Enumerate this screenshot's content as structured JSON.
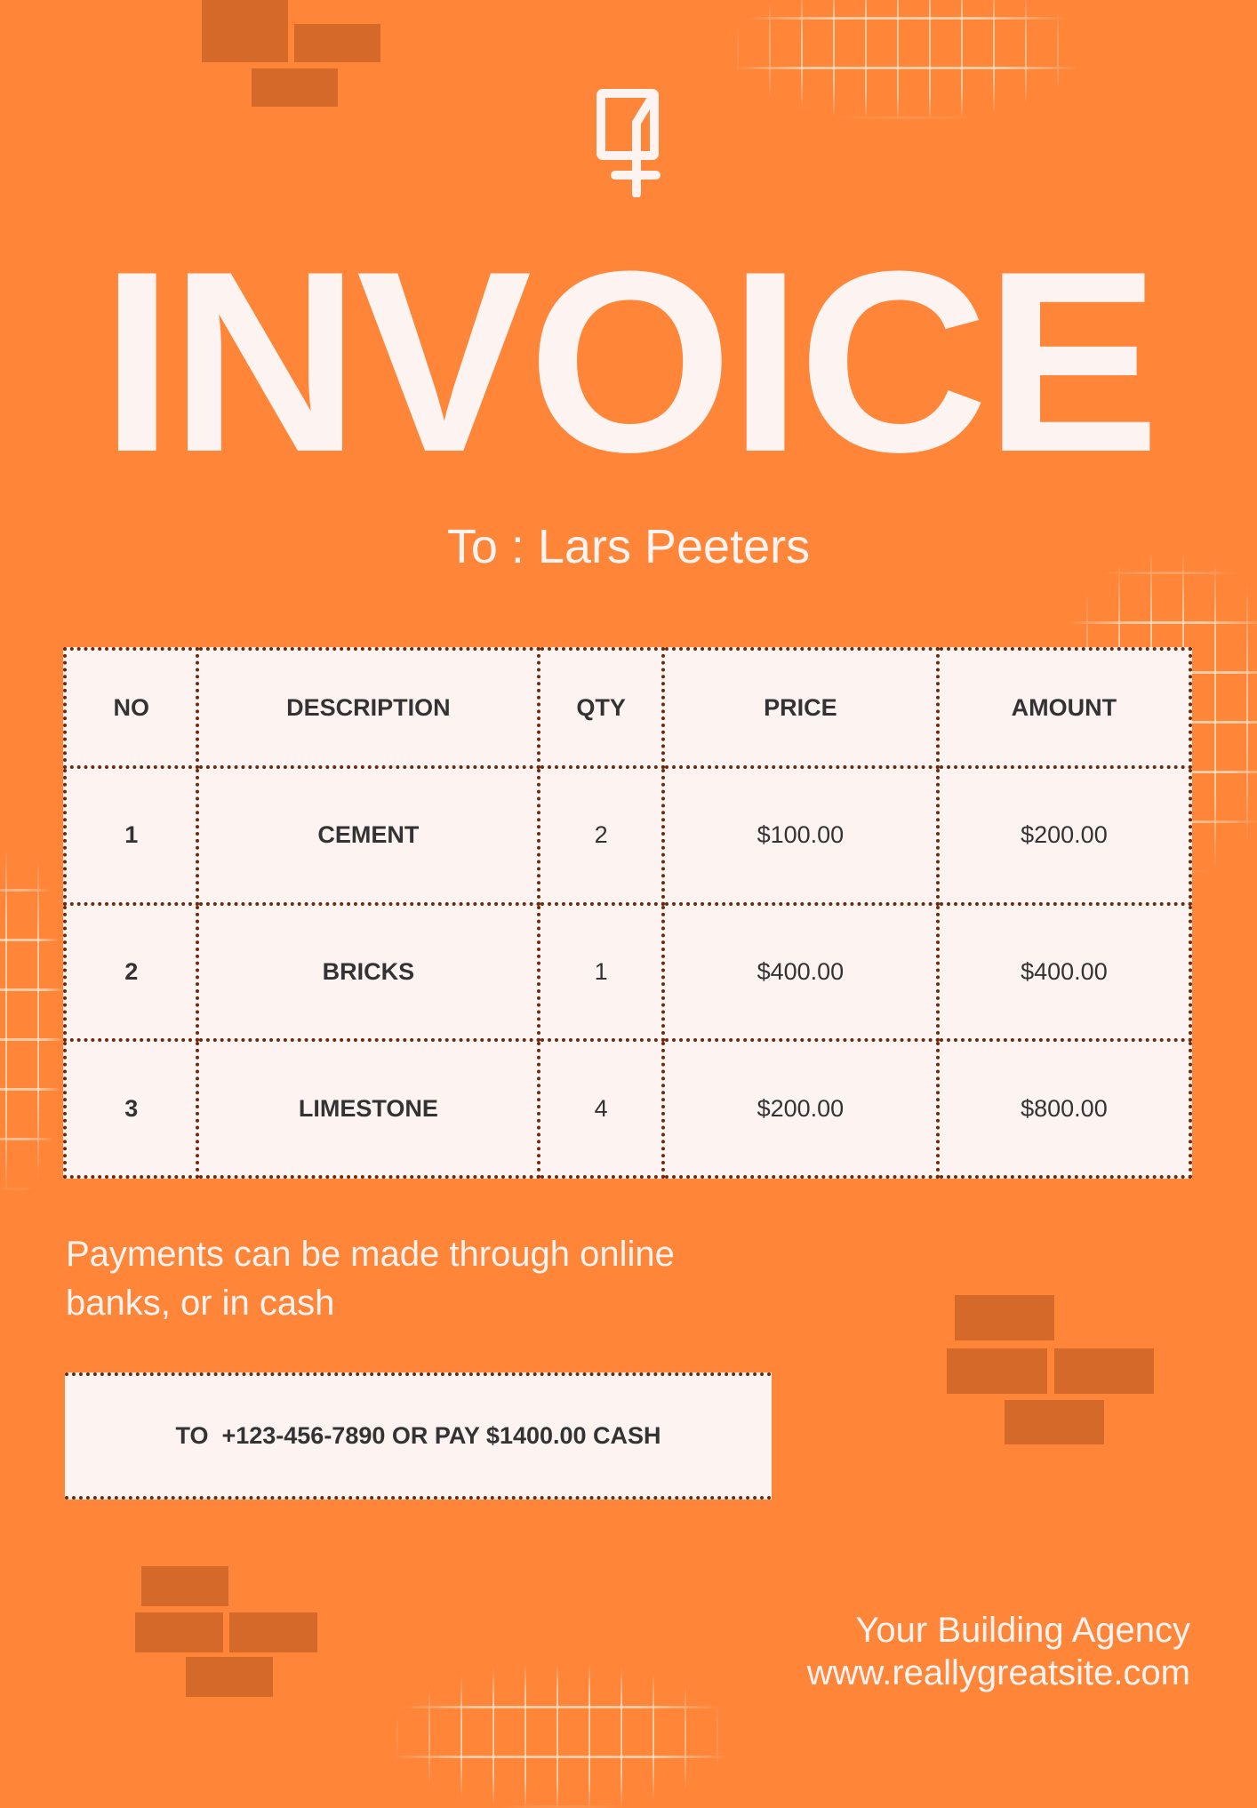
{
  "title": "INVOICE",
  "recipient": "To : Lars Peeters",
  "table": {
    "headers": [
      "NO",
      "DESCRIPTION",
      "QTY",
      "PRICE",
      "AMOUNT"
    ],
    "rows": [
      {
        "no": "1",
        "description": "CEMENT",
        "qty": "2",
        "price": "$100.00",
        "amount": "$200.00"
      },
      {
        "no": "2",
        "description": "BRICKS",
        "qty": "1",
        "price": "$400.00",
        "amount": "$400.00"
      },
      {
        "no": "3",
        "description": "LIMESTONE",
        "qty": "4",
        "price": "$200.00",
        "amount": "$800.00"
      }
    ]
  },
  "payment_note": {
    "line1": "Payments can be made through online",
    "line2": "banks, or in cash"
  },
  "payment_box": "TO  +123-456-7890 OR PAY $1400.00 CASH",
  "footer": {
    "agency": "Your Building Agency",
    "website": "www.reallygreatsite.com"
  },
  "colors": {
    "background": "#ff8538",
    "brick": "#d4692a",
    "paper": "#fdf3f1",
    "dots": "#6b2a0e"
  }
}
